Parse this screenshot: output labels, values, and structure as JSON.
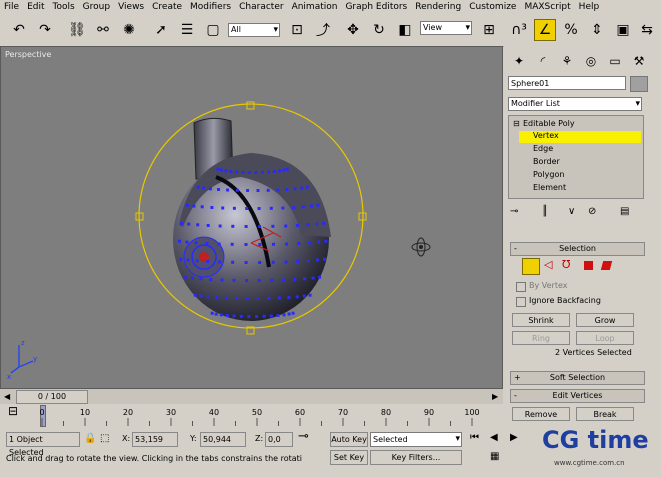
{
  "menu": [
    "File",
    "Edit",
    "Tools",
    "Group",
    "Views",
    "Create",
    "Modifiers",
    "Character",
    "Animation",
    "Graph Editors",
    "Rendering",
    "Customize",
    "MAXScript",
    "Help"
  ],
  "toolbar": {
    "selection_filter": "All",
    "reference_coord": "View"
  },
  "viewport": {
    "label": "Perspective",
    "accent": "#f0c800",
    "vertex_color": "#2a2aff"
  },
  "command_panel": {
    "object_name": "Sphere01",
    "modifier_list": "Modifier List",
    "stack": {
      "root": "Editable Poly",
      "items": [
        "Vertex",
        "Edge",
        "Border",
        "Polygon",
        "Element"
      ],
      "selected": "Vertex"
    },
    "selection_rollout": {
      "title": "Selection",
      "by_vertex": "By Vertex",
      "ignore_backfacing": "Ignore Backfacing",
      "shrink": "Shrink",
      "grow": "Grow",
      "ring": "Ring",
      "loop": "Loop",
      "status": "2 Vertices Selected"
    },
    "soft_selection": "Soft Selection",
    "edit_vertices": {
      "title": "Edit Vertices",
      "remove": "Remove",
      "break": "Break"
    }
  },
  "timeline": {
    "frame": "0 / 100",
    "ticks": [
      "0",
      "10",
      "20",
      "30",
      "40",
      "50",
      "60",
      "70",
      "80",
      "90",
      "100"
    ]
  },
  "status": {
    "selection": "1 Object Selected",
    "x_label": "X:",
    "x_value": "53,159",
    "y_label": "Y:",
    "y_value": "50,944",
    "z_label": "Z:",
    "z_value": "0,0",
    "auto_key": "Auto Key",
    "set_key": "Set Key",
    "key_mode": "Selected",
    "key_filters": "Key Filters...",
    "prompt": "Click and drag to rotate the view.  Clicking in the tabs constrains the rotati"
  },
  "watermark": {
    "brand": "CG time",
    "url": "www.cgtime.com.cn"
  }
}
